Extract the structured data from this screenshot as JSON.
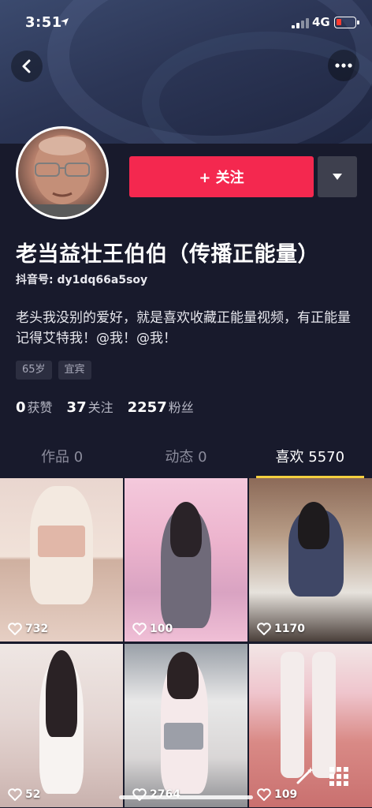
{
  "status_bar": {
    "time": "3:51",
    "network": "4G"
  },
  "profile": {
    "follow_label": "+ 关注",
    "nickname": "老当益壮王伯伯（传播正能量）",
    "douyin_id": "抖音号: dy1dq66a5soy",
    "bio": "老头我没别的爱好，就是喜欢收藏正能量视频，有正能量记得艾特我！@我！@我！",
    "tags": [
      "65岁",
      "宜宾"
    ],
    "stats": [
      {
        "num": "0",
        "label": "获赞"
      },
      {
        "num": "37",
        "label": "关注"
      },
      {
        "num": "2257",
        "label": "粉丝"
      }
    ]
  },
  "tabs": [
    {
      "label": "作品 0"
    },
    {
      "label": "动态 0"
    },
    {
      "label": "喜欢 5570"
    }
  ],
  "active_tab": "喜欢 5570",
  "grid": [
    {
      "likes": "732"
    },
    {
      "likes": "100"
    },
    {
      "likes": "1170"
    },
    {
      "likes": "52"
    },
    {
      "likes": "2764"
    },
    {
      "likes": "109"
    }
  ],
  "colors": {
    "accent": "#f4284f",
    "tab_indicator": "#f4d03f",
    "background": "#181a2c"
  }
}
